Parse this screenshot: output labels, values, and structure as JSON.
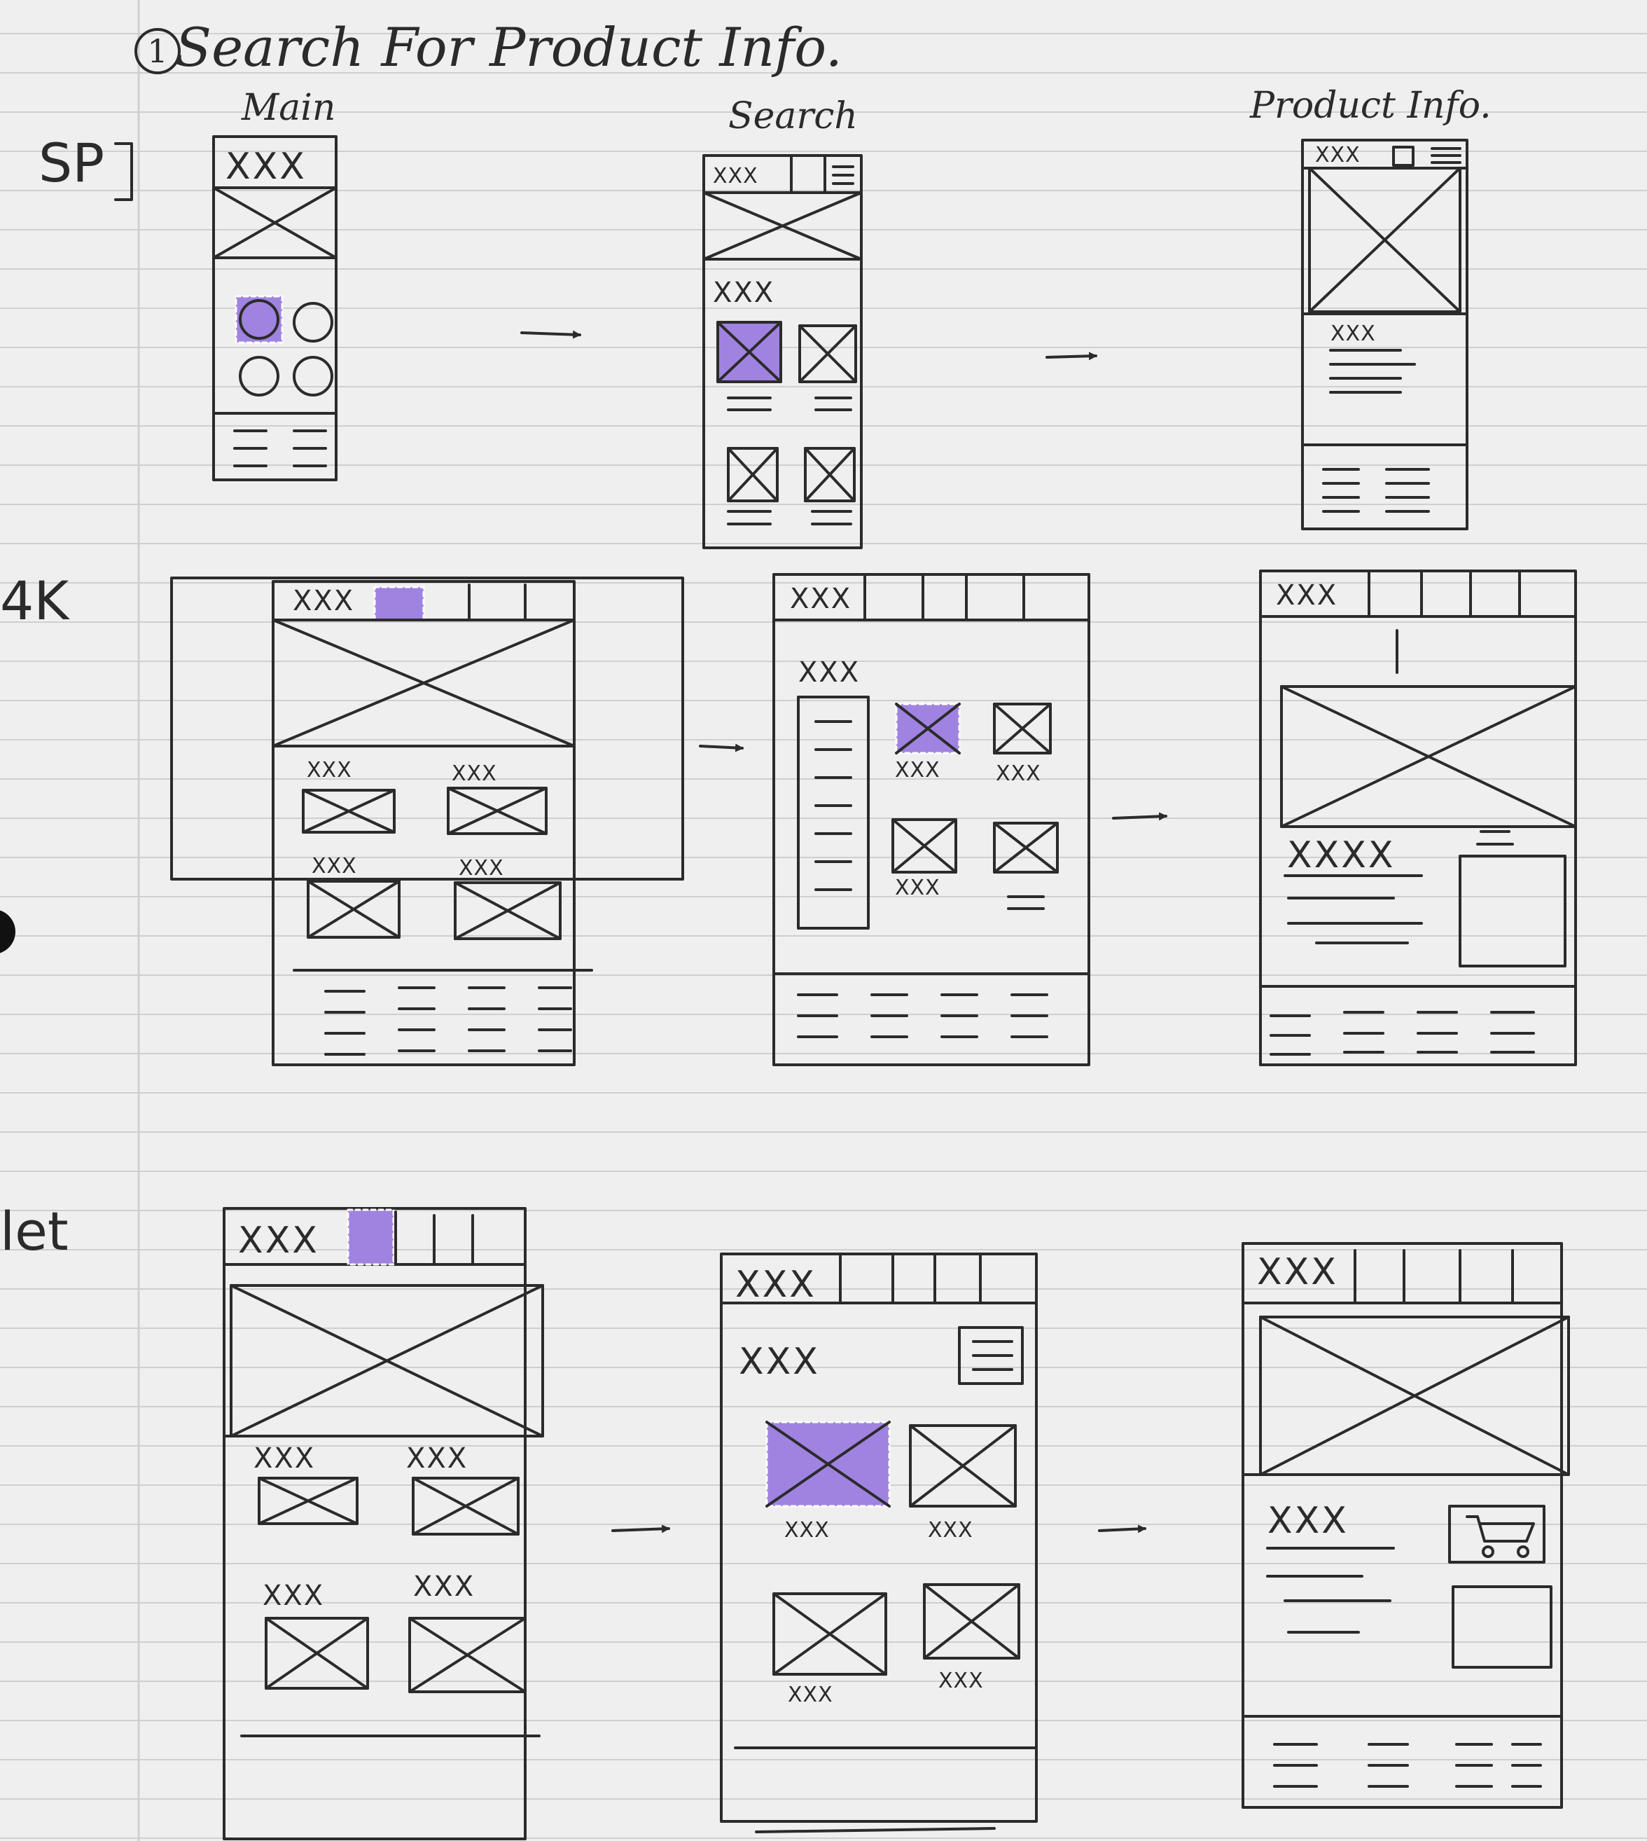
{
  "title": "Search For Product Info.",
  "step_number": "1",
  "columns": [
    "Main",
    "Search",
    "Product Info."
  ],
  "rows": [
    "SP",
    "4K",
    "let"
  ],
  "placeholder_text": "XXX",
  "placeholder_text_long": "XXXX",
  "highlight_color": "#a083e0",
  "ink_color": "#2b2b2b",
  "paper_color": "#efefef",
  "rule_color": "#cfcfcf"
}
